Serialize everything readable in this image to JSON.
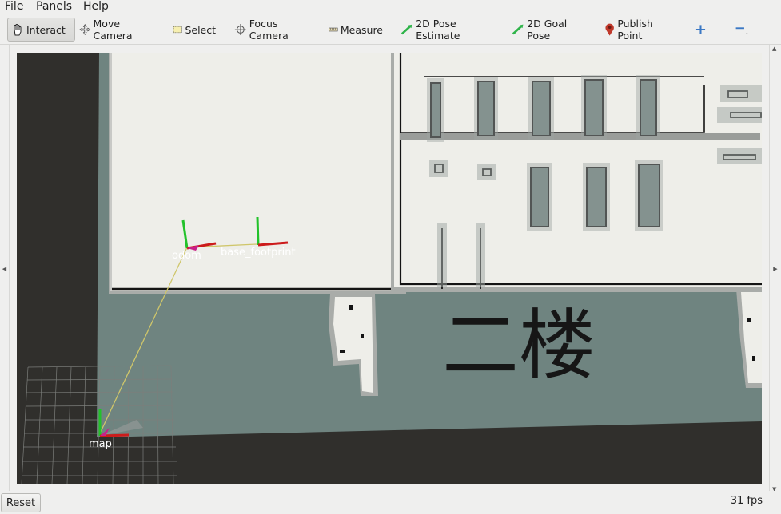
{
  "menu": {
    "file": "File",
    "panels": "Panels",
    "help": "Help"
  },
  "toolbar": {
    "interact": "Interact",
    "move_camera": "Move Camera",
    "select": "Select",
    "focus_camera": "Focus Camera",
    "measure": "Measure",
    "pose_estimate": "2D Pose Estimate",
    "goal_pose": "2D Goal Pose",
    "publish_point": "Publish Point",
    "add_icon": "plus-icon",
    "remove_icon": "minus-icon"
  },
  "viewport": {
    "frames": {
      "odom": "odom",
      "base": "base_footprint",
      "map": "map"
    },
    "floor_label": "二楼",
    "colors": {
      "unknown": "#302f2c",
      "free": "#efefea",
      "occupied": "#141414",
      "inflation": "#6e8480",
      "cost": "#8a8a87"
    }
  },
  "status": {
    "reset_label": "Reset",
    "fps": "31 fps"
  }
}
